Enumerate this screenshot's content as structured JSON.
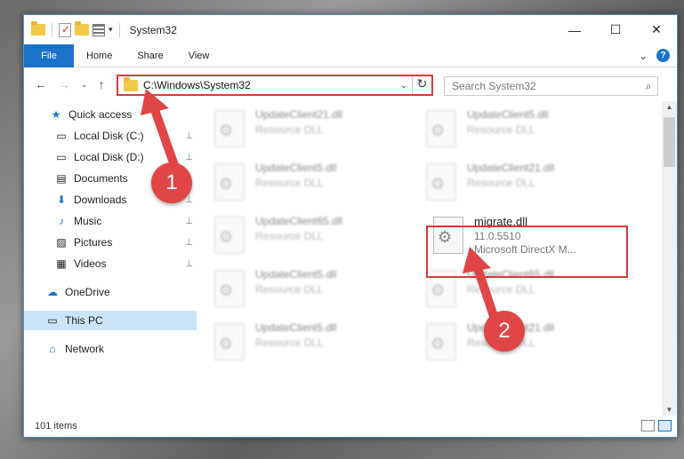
{
  "window": {
    "title": "System32",
    "controls": {
      "minimize": "—",
      "maximize": "☐",
      "close": "✕"
    }
  },
  "ribbon": {
    "file_tab": "File",
    "tabs": [
      "Home",
      "Share",
      "View"
    ],
    "expand_glyph": "⌄",
    "help_glyph": "?"
  },
  "address": {
    "path": "C:\\Windows\\System32",
    "dropdown_glyph": "⌄",
    "refresh_glyph": "↻"
  },
  "nav": {
    "back": "←",
    "forward": "→",
    "recent": "⌄",
    "up": "↑"
  },
  "search": {
    "placeholder": "Search System32",
    "icon_glyph": "⌕"
  },
  "sidebar": {
    "items": [
      {
        "label": "Quick access",
        "icon": "★",
        "pinned": false
      },
      {
        "label": "Local Disk (C:)",
        "icon": "▭",
        "pinned": true
      },
      {
        "label": "Local Disk (D:)",
        "icon": "▭",
        "pinned": true
      },
      {
        "label": "Documents",
        "icon": "▤",
        "pinned": true
      },
      {
        "label": "Downloads",
        "icon": "⬇",
        "pinned": true
      },
      {
        "label": "Music",
        "icon": "♪",
        "pinned": true
      },
      {
        "label": "Pictures",
        "icon": "▨",
        "pinned": true
      },
      {
        "label": "Videos",
        "icon": "▦",
        "pinned": true
      },
      {
        "label": "OneDrive",
        "icon": "☁",
        "pinned": false
      },
      {
        "label": "This PC",
        "icon": "▭",
        "pinned": false
      },
      {
        "label": "Network",
        "icon": "⌂",
        "pinned": false
      }
    ],
    "pin_glyph": "📌"
  },
  "files": [
    {
      "name": "UpdateClient21.dll",
      "meta": "Resource DLL",
      "sub": ""
    },
    {
      "name": "UpdateClient5.dll",
      "meta": "Resource DLL",
      "sub": ""
    },
    {
      "name": "UpdateClient5.dll",
      "meta": "Resource DLL",
      "sub": ""
    },
    {
      "name": "UpdateClient21.dll",
      "meta": "Resource DLL",
      "sub": ""
    },
    {
      "name": "UpdateClient65.dll",
      "meta": "Resource DLL",
      "sub": ""
    },
    {
      "name": "migrate.dll",
      "meta": "11.0.5510",
      "sub": "Microsoft DirectX M..."
    },
    {
      "name": "UpdateClient5.dll",
      "meta": "Resource DLL",
      "sub": ""
    },
    {
      "name": "UpdateClient65.dll",
      "meta": "Resource DLL",
      "sub": ""
    },
    {
      "name": "UpdateClient5.dll",
      "meta": "Resource DLL",
      "sub": ""
    },
    {
      "name": "UpdateClient21.dll",
      "meta": "Resource DLL",
      "sub": ""
    }
  ],
  "status": {
    "items_count": "101 items"
  },
  "callouts": {
    "step1": "1",
    "step2": "2",
    "color": "#e04646"
  },
  "scroll": {
    "up": "▲",
    "down": "▼"
  }
}
